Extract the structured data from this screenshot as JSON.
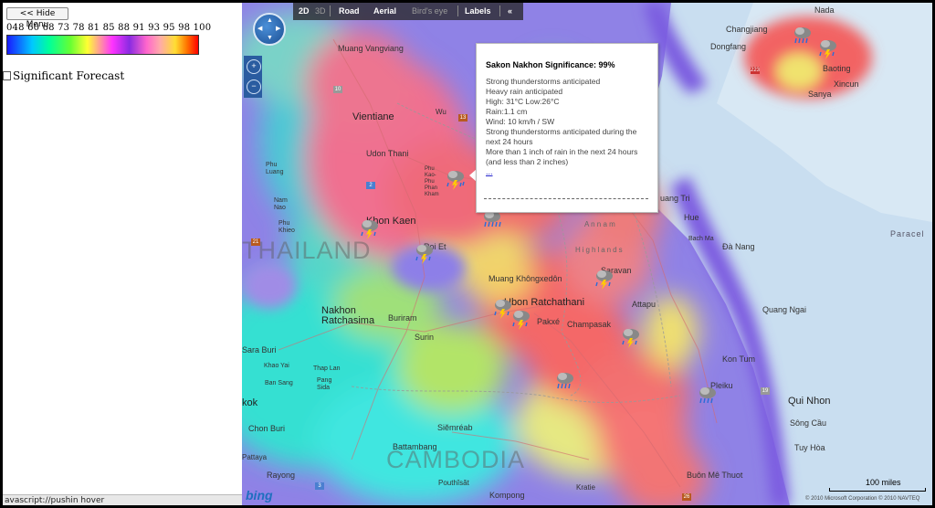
{
  "sidebar": {
    "hide_menu_label": "<< Hide Menu",
    "scale_numbers": "048 60 68 73 78 81 85 88 91 93 95 98 100",
    "significant_label": "Significant Forecast"
  },
  "status_bar": {
    "text": "avascript://pushin hover"
  },
  "map": {
    "topbar": {
      "mode_2d": "2D",
      "mode_3d": "3D",
      "road": "Road",
      "aerial": "Aerial",
      "birds_eye": "Bird's eye",
      "labels": "Labels",
      "collapse": "«"
    },
    "zoom_in": "+",
    "zoom_out": "−",
    "scale_label": "100 miles",
    "copyright": "© 2010 Microsoft Corporation   © 2010 NAVTEQ",
    "bing_logo": "bing",
    "places": {
      "muang_vangviang": "Muang Vangviang",
      "vientiane": "Vientiane",
      "udon_thani": "Udon Thani",
      "phu_luang": "Phu\nLuang",
      "nam_nao": "Nam\nNao",
      "phu_khieo": "Phu\nKhieo",
      "khon_kaen": "Khon Kaen",
      "thailand": "THAILAND",
      "roi_et": "Roi Et",
      "nakhon_ratchasima": "Nakhon\nRatchasima",
      "buriram": "Buriram",
      "surin": "Surin",
      "sara_buri": "Sara Buri",
      "khao_yai": "Khao Yai",
      "ban_sang": "Ban Sang",
      "thap_lan": "Thap Lan",
      "pang_sida": "Pang\nSida",
      "kok": "kok",
      "chon_buri": "Chon Buri",
      "pattaya": "Pattaya",
      "rayong": "Rayong",
      "siemreab": "Siĕmréab",
      "battambang": "Battambang",
      "pouthisat": "Pouthĭsăt",
      "cambodia": "CAMBODIA",
      "kompong": "Kompong",
      "kratie": "Kratie",
      "muang_khong": "Muang Khôngxedôn",
      "ubon": "Ubon Ratchathani",
      "pakxe": "Pakxé",
      "champasak": "Champasak",
      "saravan": "Saravan",
      "attapu": "Attapu",
      "kon_tum": "Kon Tum",
      "pleiku": "Pleiku",
      "buon_me_thuot": "Buôn Mê Thuot",
      "qui_nhon": "Qui Nhon",
      "song_cau": "Sông Cầu",
      "tuy_hoa": "Tuy Hòa",
      "quang_ngai": "Quang Ngai",
      "da_nang": "Đà Nang",
      "hue": "Hue",
      "quang_tri": "uang Tri",
      "bach_ma": "Bach Ma",
      "paracel": "Paracel",
      "changjiang": "Changjiang",
      "dongfang": "Dongfang",
      "baoting": "Baoting",
      "xincun": "Xincun",
      "sanya": "Sanya",
      "nada": "Nada",
      "phu_kao": "Phu\nKao-\nPhu\nPhan\nKham",
      "wu": "Wu",
      "highlands": "Highlands",
      "annam": "A n n a m"
    },
    "popup": {
      "title": "Sakon Nakhon Significance: 99%",
      "lines": [
        "Strong thunderstorms anticipated",
        "Heavy rain anticipated",
        "High: 31°C Low:26°C",
        "Rain:1.1 cm",
        "Wind: 10 km/h / SW",
        "Strong thunderstorms anticipated during the next 24 hours",
        "More than 1 inch of rain in the next 24 hours (and less than 2 inches)"
      ],
      "more_link": "..."
    }
  }
}
